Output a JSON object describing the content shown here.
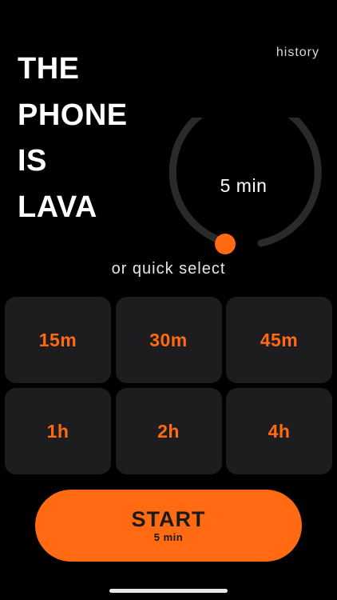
{
  "header": {
    "history_label": "history"
  },
  "title": {
    "lines": [
      "THE",
      "PHONE",
      "IS",
      "LAVA"
    ]
  },
  "timer": {
    "value_label": "5 min",
    "minutes": 5
  },
  "quick_select": {
    "label": "or quick select",
    "options": [
      "15m",
      "30m",
      "45m",
      "1h",
      "2h",
      "4h"
    ]
  },
  "start_button": {
    "label": "START",
    "sublabel": "5 min"
  },
  "colors": {
    "accent": "#ff6a13",
    "background": "#000000",
    "tile": "#1d1d1f",
    "ring": "#2a2a2a"
  }
}
